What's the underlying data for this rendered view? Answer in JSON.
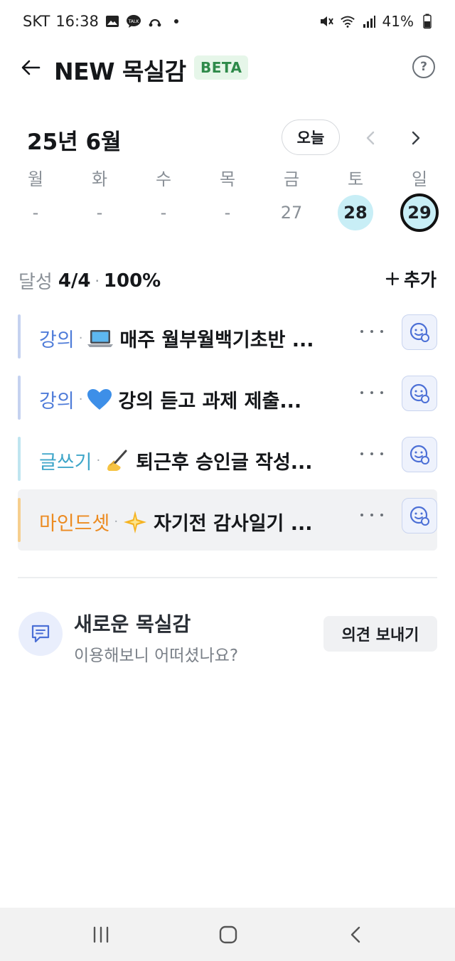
{
  "status_bar": {
    "carrier": "SKT",
    "time": "16:38",
    "battery": "41%"
  },
  "header": {
    "title": "NEW 목실감",
    "badge": "BETA"
  },
  "calendar": {
    "month_label": "25년 6월",
    "today_button": "오늘",
    "weekdays": [
      "월",
      "화",
      "수",
      "목",
      "금",
      "토",
      "일"
    ],
    "dates": [
      "-",
      "-",
      "-",
      "-",
      "27",
      "28",
      "29"
    ]
  },
  "progress": {
    "label": "달성",
    "count": "4/4",
    "percent": "100%",
    "add_label": "추가"
  },
  "goals": [
    {
      "category": "강의",
      "emoji": "laptop-icon",
      "name": "매주 월부월백기초반 ...",
      "color": "#4f7cd9",
      "bar": "#c5d2f0"
    },
    {
      "category": "강의",
      "emoji": "blue-heart-icon",
      "name": "강의 듣고 과제 제출...",
      "color": "#4f7cd9",
      "bar": "#c5d2f0"
    },
    {
      "category": "글쓰기",
      "emoji": "writing-hand-icon",
      "name": "퇴근후 승인글 작성...",
      "color": "#3fa6c9",
      "bar": "#bfe5f0"
    },
    {
      "category": "마인드셋",
      "emoji": "sparkle-star-icon",
      "name": "자기전 감사일기 ...",
      "color": "#ec8b21",
      "bar": "#f6cf8e"
    }
  ],
  "feedback": {
    "title": "새로운 목실감",
    "subtitle": "이용해보니 어떠셨나요?",
    "button": "의견 보내기"
  },
  "colors": {
    "accent_cyan": "#c8eef6",
    "beta_bg": "#e6f6e9",
    "beta_text": "#2e8a4a"
  }
}
